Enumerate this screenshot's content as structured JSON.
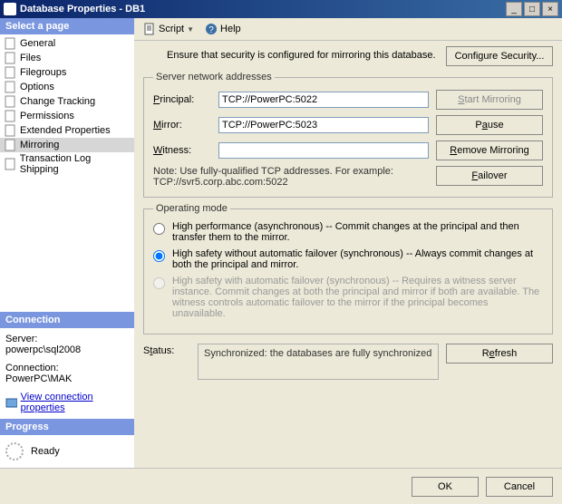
{
  "window": {
    "title": "Database Properties - DB1",
    "min": "_",
    "max": "□",
    "close": "×"
  },
  "toolbar": {
    "script": "Script",
    "help": "Help"
  },
  "sidebar": {
    "header": "Select a page",
    "items": [
      {
        "label": "General"
      },
      {
        "label": "Files"
      },
      {
        "label": "Filegroups"
      },
      {
        "label": "Options"
      },
      {
        "label": "Change Tracking"
      },
      {
        "label": "Permissions"
      },
      {
        "label": "Extended Properties"
      },
      {
        "label": "Mirroring"
      },
      {
        "label": "Transaction Log Shipping"
      }
    ]
  },
  "connection": {
    "header": "Connection",
    "server_label": "Server:",
    "server_value": "powerpc\\sql2008",
    "conn_label": "Connection:",
    "conn_value": "PowerPC\\MAK",
    "view_link": "View connection properties"
  },
  "progress": {
    "header": "Progress",
    "status": "Ready"
  },
  "security": {
    "note": "Ensure that security is configured for mirroring this database.",
    "button": "Configure Security..."
  },
  "network": {
    "legend": "Server network addresses",
    "principal_label": "Principal:",
    "principal_value": "TCP://PowerPC:5022",
    "mirror_label": "Mirror:",
    "mirror_value": "TCP://PowerPC:5023",
    "witness_label": "Witness:",
    "witness_value": "",
    "start_btn": "Start Mirroring",
    "pause_btn": "Pause",
    "remove_btn": "Remove Mirroring",
    "failover_btn": "Failover",
    "tcpnote": "Note: Use fully-qualified TCP addresses. For example: TCP://svr5.corp.abc.com:5022"
  },
  "operating": {
    "legend": "Operating mode",
    "high_perf": "High performance (asynchronous) -- Commit changes at the principal and then transfer them to the mirror.",
    "high_safety_no_auto": "High safety without automatic failover (synchronous) -- Always commit changes at both the principal and mirror.",
    "high_safety_auto": "High safety with automatic failover (synchronous) -- Requires a witness server instance. Commit changes at both the principal and mirror if both are available. The witness controls automatic failover to the mirror if the principal becomes unavailable."
  },
  "status": {
    "label": "Status:",
    "text": "Synchronized: the databases are fully synchronized",
    "refresh": "Refresh"
  },
  "footer": {
    "ok": "OK",
    "cancel": "Cancel"
  }
}
